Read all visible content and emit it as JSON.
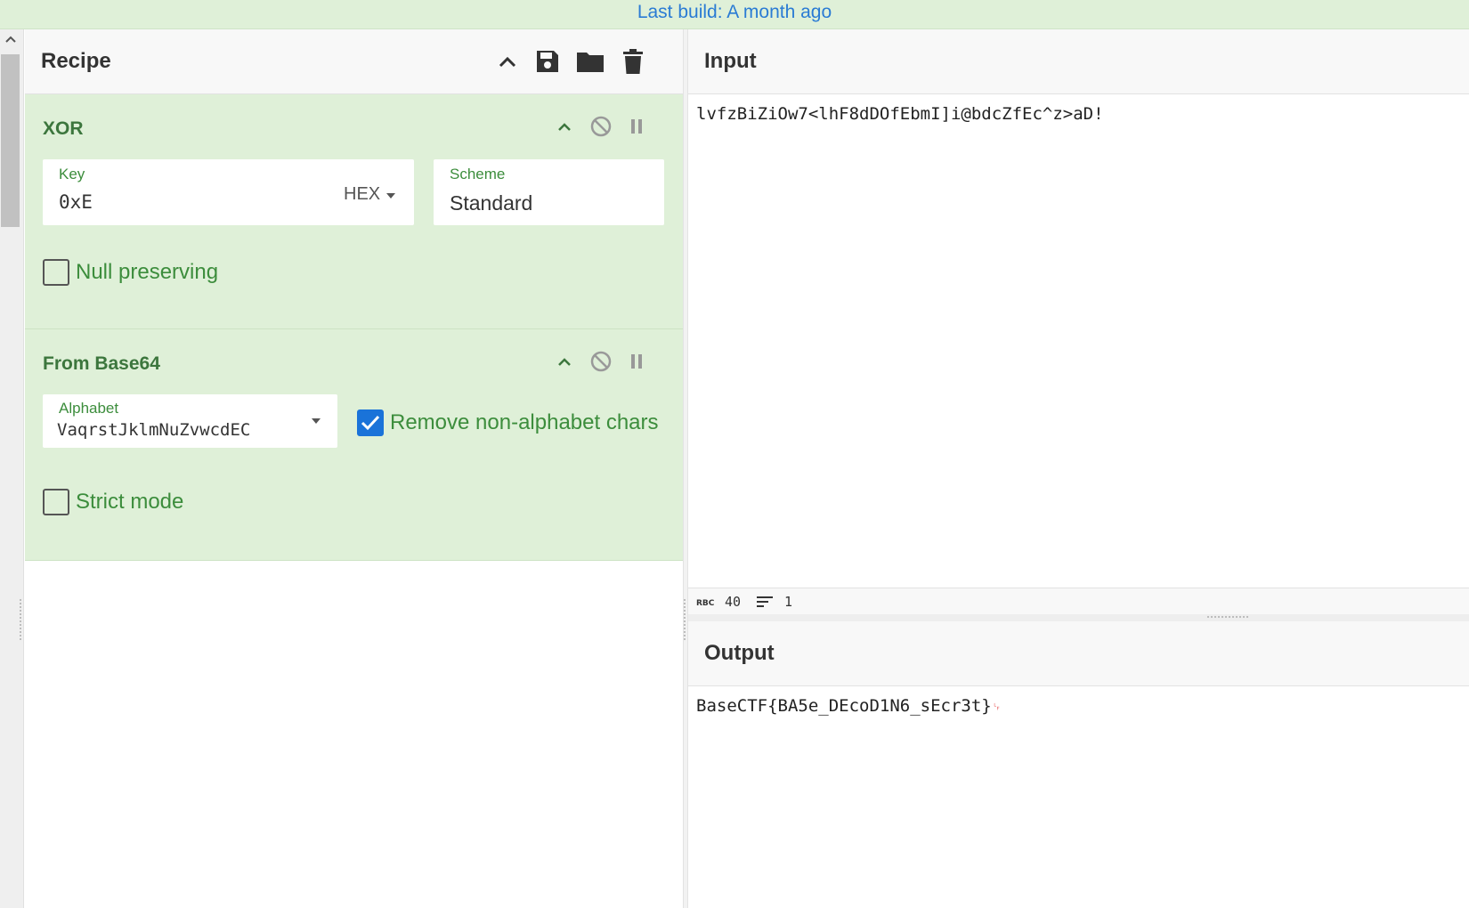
{
  "banner": {
    "text": "Last build: A month ago"
  },
  "recipe": {
    "title": "Recipe",
    "operations": [
      {
        "name": "XOR",
        "key": {
          "label": "Key",
          "value": "0xE",
          "encoding": "HEX"
        },
        "scheme": {
          "label": "Scheme",
          "value": "Standard"
        },
        "null_preserving": {
          "label": "Null preserving",
          "checked": false
        }
      },
      {
        "name": "From Base64",
        "alphabet": {
          "label": "Alphabet",
          "value": "VaqrstJklmNuZvwcdEC"
        },
        "remove_non_alphabet": {
          "label": "Remove non-alphabet chars",
          "checked": true
        },
        "strict_mode": {
          "label": "Strict mode",
          "checked": false
        }
      }
    ]
  },
  "input": {
    "title": "Input",
    "text": "lvfzBiZiOw7<lhF8dDOfEbmI]i@bdcZfEc^z>aD!",
    "char_count": "40",
    "line_count": "1"
  },
  "output": {
    "title": "Output",
    "text": "BaseCTF{BA5e_DEcoD1N6_sEcr3t}"
  },
  "colors": {
    "accent_green": "#3c763d",
    "op_bg": "#dff0d8",
    "checkbox_blue": "#1a73d9",
    "banner_link": "#2a7bd4"
  }
}
